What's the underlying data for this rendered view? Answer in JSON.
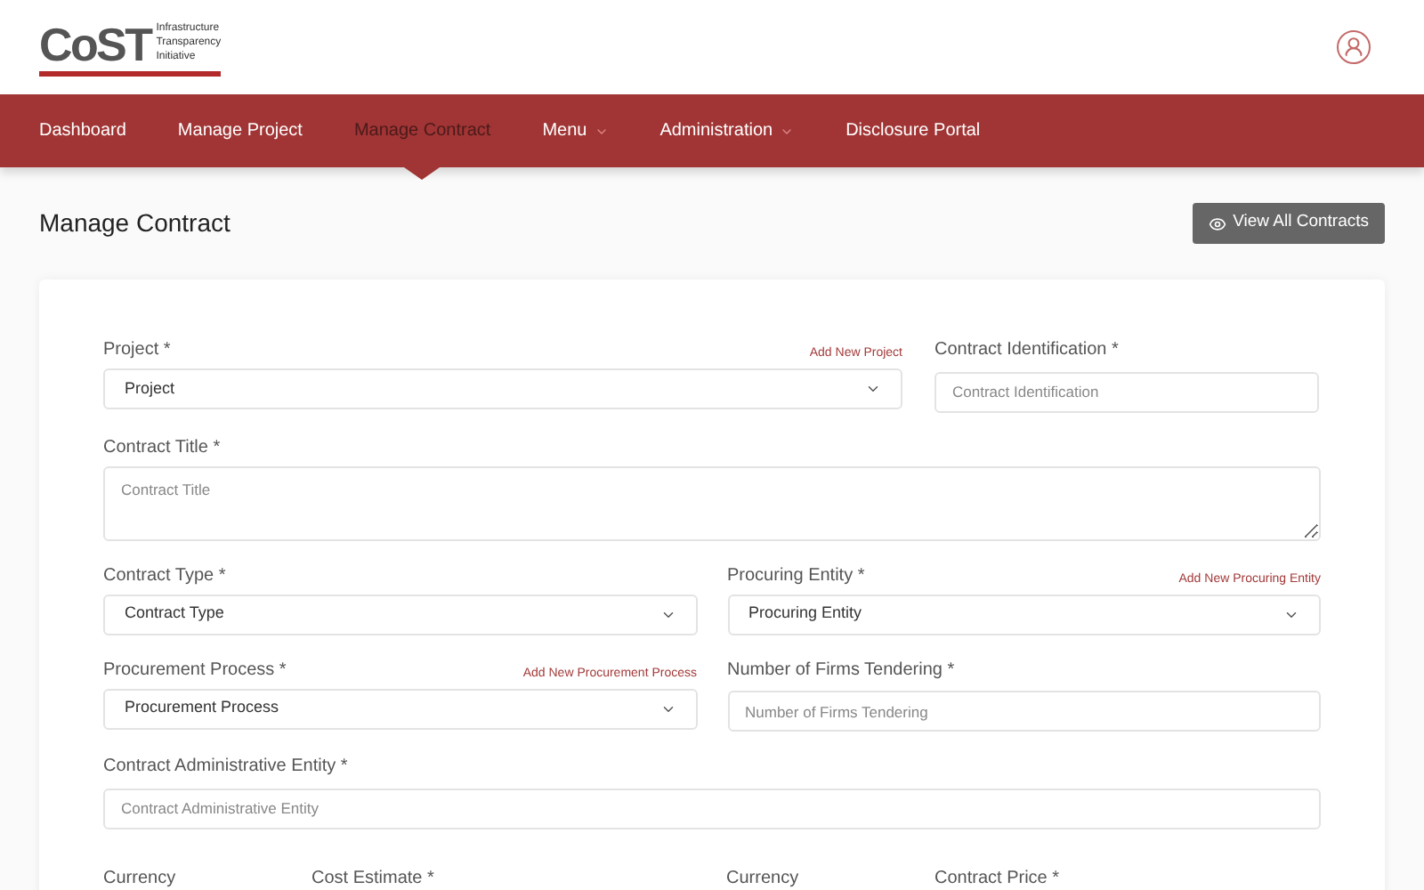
{
  "logo": {
    "mark": "CoST",
    "lines": [
      "Infrastructure",
      "Transparency",
      "Initiative"
    ]
  },
  "nav": [
    {
      "label": "Dashboard",
      "selected": false,
      "dropdown": false
    },
    {
      "label": "Manage Project",
      "selected": false,
      "dropdown": false
    },
    {
      "label": "Manage Contract",
      "selected": true,
      "dropdown": false
    },
    {
      "label": "Menu",
      "selected": false,
      "dropdown": true
    },
    {
      "label": "Administration",
      "selected": false,
      "dropdown": true
    },
    {
      "label": "Disclosure Portal",
      "selected": false,
      "dropdown": false
    }
  ],
  "page_title": "Manage Contract",
  "view_button": "View All Contracts",
  "form_rows": [
    {
      "kind": "wide-left",
      "fields": [
        {
          "kind": "select",
          "label": "Project *",
          "link": "Add New Project",
          "value": "Project"
        },
        {
          "kind": "input",
          "label": "Contract Identification *",
          "placeholder": "Contract Identification"
        }
      ]
    },
    {
      "kind": "full",
      "fields": [
        {
          "kind": "textarea",
          "label": "Contract Title *",
          "placeholder": "Contract Title"
        }
      ]
    },
    {
      "kind": "halves",
      "fields": [
        {
          "kind": "select",
          "label": "Contract Type *",
          "value": "Contract Type"
        },
        {
          "kind": "select",
          "label": "Procuring Entity *",
          "link": "Add New Procuring Entity",
          "value": "Procuring Entity"
        }
      ]
    },
    {
      "kind": "halves",
      "fields": [
        {
          "kind": "select",
          "label": "Procurement Process *",
          "link": "Add New Procurement Process",
          "value": "Procurement Process"
        },
        {
          "kind": "input",
          "label": "Number of Firms Tendering *",
          "placeholder": "Number of Firms Tendering"
        }
      ]
    },
    {
      "kind": "full",
      "fields": [
        {
          "kind": "input",
          "label": "Contract Administrative Entity *",
          "placeholder": "Contract Administrative Entity"
        }
      ]
    },
    {
      "kind": "quarters",
      "fields": [
        {
          "kind": "label",
          "label": "Currency"
        },
        {
          "kind": "label",
          "label": "Cost Estimate *"
        },
        {
          "kind": "label",
          "label": "Currency"
        },
        {
          "kind": "label",
          "label": "Contract Price *"
        }
      ]
    }
  ]
}
